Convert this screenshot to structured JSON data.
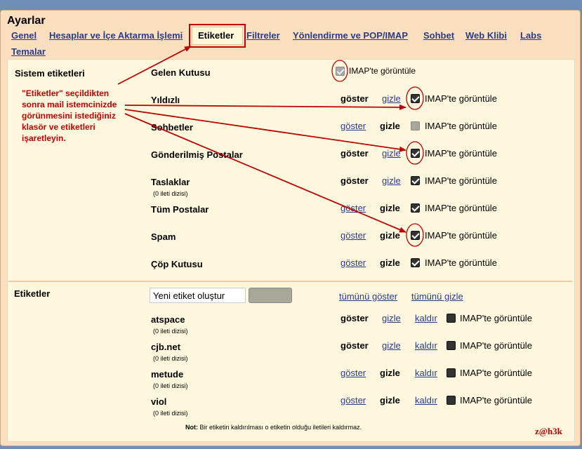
{
  "header": {
    "title": "Ayarlar",
    "tabs": [
      {
        "label": "Genel"
      },
      {
        "label": "Hesaplar ve İçe Aktarma İşlemi"
      },
      {
        "label": "Etiketler"
      },
      {
        "label": "Filtreler"
      },
      {
        "label": "Yönlendirme ve POP/IMAP"
      },
      {
        "label": "Sohbet"
      },
      {
        "label": "Web Klibi"
      },
      {
        "label": "Labs"
      },
      {
        "label": "Temalar"
      }
    ]
  },
  "system_labels": {
    "heading": "Sistem etiketleri",
    "rows": [
      {
        "name": "Gelen Kutusu",
        "imap": "IMAP'te görüntüle"
      },
      {
        "name": "Yıldızlı",
        "show": "göster",
        "hide": "gizle",
        "imap": "IMAP'te görüntüle"
      },
      {
        "name": "Sohbetler",
        "show": "göster",
        "hide": "gizle",
        "imap": "IMAP'te görüntüle"
      },
      {
        "name": "Gönderilmiş Postalar",
        "show": "göster",
        "hide": "gizle",
        "imap": "IMAP'te görüntüle"
      },
      {
        "name": "Taslaklar",
        "sub": "(0 ileti dizisi)",
        "show": "göster",
        "hide": "gizle",
        "imap": "IMAP'te görüntüle"
      },
      {
        "name": "Tüm Postalar",
        "show": "göster",
        "hide": "gizle",
        "imap": "IMAP'te görüntüle"
      },
      {
        "name": "Spam",
        "show": "göster",
        "hide": "gizle",
        "imap": "IMAP'te görüntüle"
      },
      {
        "name": "Çöp Kutusu",
        "show": "göster",
        "hide": "gizle",
        "imap": "IMAP'te görüntüle"
      }
    ]
  },
  "labels": {
    "heading": "Etiketler",
    "new_label_value": "Yeni etiket oluştur",
    "show_all": "tümünü göster",
    "hide_all": "tümünü gizle",
    "rows": [
      {
        "name": "atspace",
        "sub": "(0 ileti dizisi)",
        "show": "göster",
        "hide": "gizle",
        "remove": "kaldır",
        "imap": "IMAP'te görüntüle"
      },
      {
        "name": "cjb.net",
        "sub": "(0 ileti dizisi)",
        "show": "göster",
        "hide": "gizle",
        "remove": "kaldır",
        "imap": "IMAP'te görüntüle"
      },
      {
        "name": "metude",
        "sub": "(0 ileti dizisi)",
        "show": "göster",
        "hide": "gizle",
        "remove": "kaldır",
        "imap": "IMAP'te görüntüle"
      },
      {
        "name": "viol",
        "sub": "(0 ileti dizisi)",
        "show": "göster",
        "hide": "gizle",
        "remove": "kaldır",
        "imap": "IMAP'te görüntüle"
      }
    ]
  },
  "note": {
    "prefix": "Not:",
    "text": " Bir etiketin kaldırılması o etiketin olduğu iletileri kaldırmaz."
  },
  "annotation": {
    "text": "\"Etiketler\" seçildikten sonra mail istemcinizde görünmesini istediğiniz klasör ve etiketleri işaretleyin.",
    "signature": "z@h3k",
    "color": "#c00000"
  },
  "colors": {
    "outer_bg": "#6f8fb7",
    "tab_bar_bg": "#fbdfbf",
    "content_bg": "#fff8de",
    "link": "#2a3b8a"
  }
}
